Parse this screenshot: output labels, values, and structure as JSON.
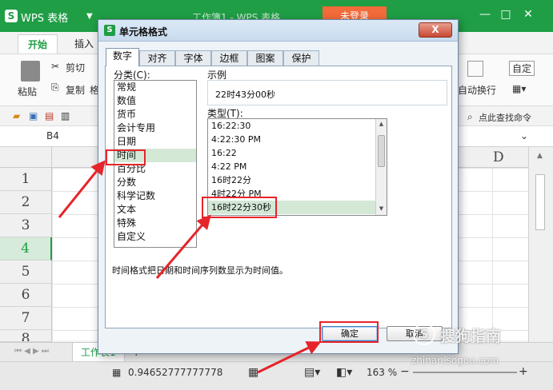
{
  "app": {
    "logo": "S",
    "name": "WPS 表格",
    "doc_title": "工作簿1 - WPS 表格",
    "login_label": "未登录",
    "accent_color": "#1f9e45"
  },
  "ribbon": {
    "tabs": [
      "开始",
      "插入"
    ],
    "paste_label": "粘贴",
    "cut_label": "剪切",
    "copy_label": "复制",
    "format_painter_label": "格",
    "wrap_label": "自动换行",
    "auto_label": "自定",
    "find_label": "点此查找命令"
  },
  "formula_bar": {
    "cell_ref": "B4"
  },
  "grid": {
    "col_d": "D",
    "rows": [
      "1",
      "2",
      "3",
      "4",
      "5",
      "6",
      "7",
      "8"
    ],
    "active_row": "4"
  },
  "sheet_tab": "工作表1",
  "status": {
    "value": "0.94652777777778",
    "zoom": "163 %"
  },
  "dialog": {
    "logo": "S",
    "title": "单元格格式",
    "close_label": "X",
    "tabs": [
      "数字",
      "对齐",
      "字体",
      "边框",
      "图案",
      "保护"
    ],
    "category_label": "分类(C):",
    "categories": [
      "常规",
      "数值",
      "货币",
      "会计专用",
      "日期",
      "时间",
      "百分比",
      "分数",
      "科学记数",
      "文本",
      "特殊",
      "自定义"
    ],
    "selected_category": "时间",
    "sample_label": "示例",
    "sample_value": "22时43分00秒",
    "type_label": "类型(T):",
    "types": [
      "16:22:30",
      "4:22:30 PM",
      "16:22",
      "4:22 PM",
      "16时22分",
      "4时22分 PM",
      "16时22分30秒"
    ],
    "selected_type": "16时22分30秒",
    "description": "时间格式把日期和时间序列数显示为时间值。",
    "ok_label": "确定",
    "cancel_label": "取消"
  },
  "watermark": {
    "brand": "搜狗指南",
    "url": "zhinan.sogou.com"
  },
  "annotation_color": "#e5252a"
}
